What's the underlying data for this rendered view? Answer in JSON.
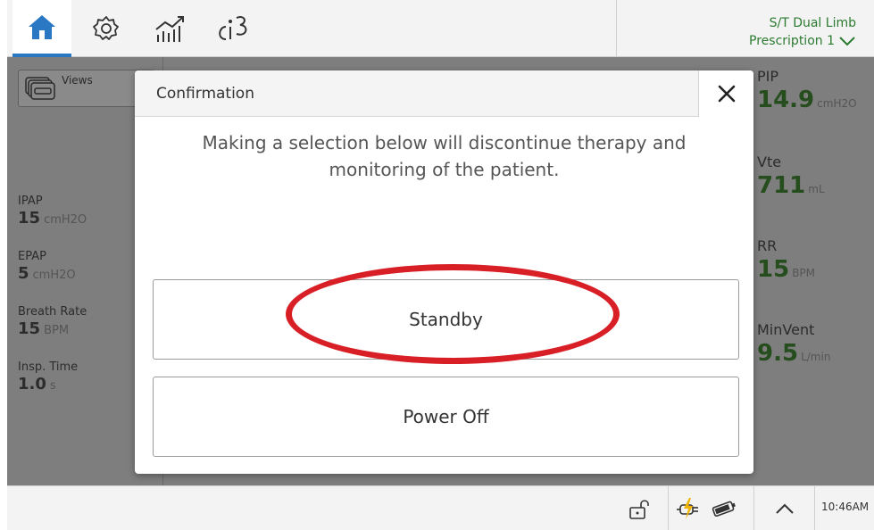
{
  "topbar": {
    "tabs": [
      {
        "name": "home",
        "icon": "home-icon",
        "active": true
      },
      {
        "name": "settings",
        "icon": "gear-icon",
        "active": false
      },
      {
        "name": "trends",
        "icon": "trends-chart-icon",
        "active": false
      },
      {
        "name": "ci",
        "icon": "ci-logo-icon",
        "active": false
      }
    ],
    "mode_line1": "S/T  Dual Limb",
    "mode_line2": "Prescription 1",
    "accent_color": "#2a77c4",
    "mode_color": "#2b7a2f"
  },
  "left_panel": {
    "views_label": "Views",
    "params": [
      {
        "name": "IPAP",
        "value": "15",
        "unit": "cmH2O"
      },
      {
        "name": "EPAP",
        "value": "5",
        "unit": "cmH2O"
      },
      {
        "name": "Breath Rate",
        "value": "15",
        "unit": "BPM"
      },
      {
        "name": "Insp. Time",
        "value": "1.0",
        "unit": "s"
      }
    ]
  },
  "monitors": [
    {
      "name": "PIP",
      "value": "14.9",
      "unit": "cmH2O"
    },
    {
      "name": "Vte",
      "value": "711",
      "unit": "mL"
    },
    {
      "name": "RR",
      "value": "15",
      "unit": "BPM"
    },
    {
      "name": "MinVent",
      "value": "9.5",
      "unit": "L/min"
    }
  ],
  "modal": {
    "title": "Confirmation",
    "message": "Making a selection below will discontinue therapy and monitoring of the patient.",
    "standby_label": "Standby",
    "power_off_label": "Power Off",
    "highlight_color": "#d91f26"
  },
  "bottombar": {
    "clock": "10:46AM"
  }
}
